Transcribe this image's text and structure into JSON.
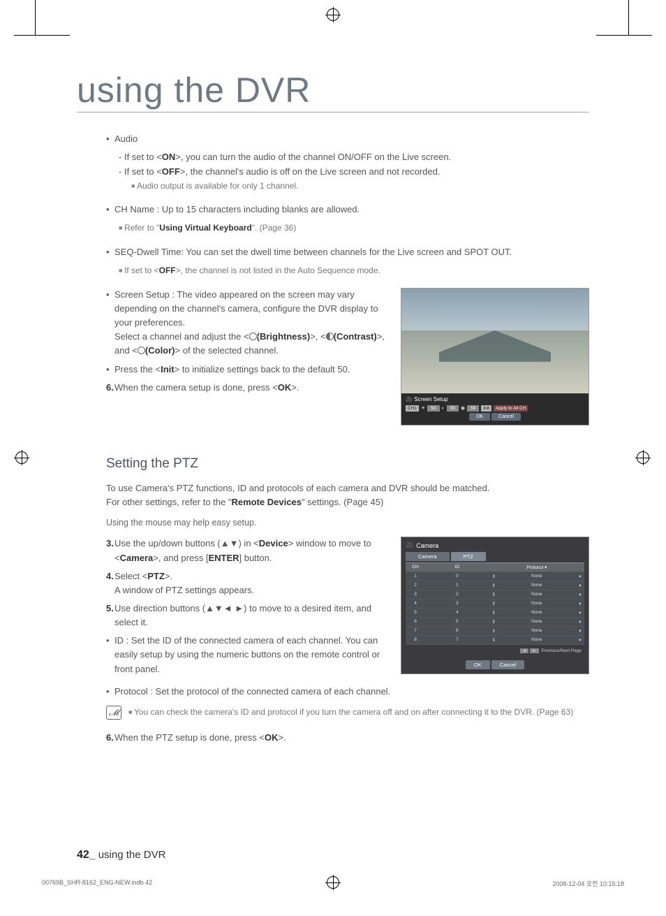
{
  "page": {
    "title": "using the DVR",
    "footer_page": "42_",
    "footer_text": "using the DVR",
    "footline_left": "00769B_SHR-8162_ENG-NEW.indb   42",
    "footline_right": "2008-12-04   오전 10:15:18"
  },
  "sec1": {
    "audio_label": "Audio",
    "audio_on": "If set to <",
    "audio_on_b": "ON",
    "audio_on_rest": ">, you can turn the audio of the channel ON/OFF on the Live screen.",
    "audio_off": "If set to <",
    "audio_off_b": "OFF",
    "audio_off_rest": ">, the channel's audio is off on the Live screen and not recorded.",
    "audio_note": "Audio output is available for only 1 channel.",
    "chname": "CH Name : Up to 15 characters including blanks are allowed.",
    "chname_note_a": "Refer to \"",
    "chname_note_b": "Using Virtual Keyboard",
    "chname_note_c": "\". (Page 36)",
    "seq": "SEQ-Dwell Time: You can set the dwell time between channels for the Live screen and SPOT OUT.",
    "seq_note_a": "If set to <",
    "seq_note_b": "OFF",
    "seq_note_c": ">, the channel is not listed in the Auto Sequence mode.",
    "screen1": "Screen Setup : The video appeared on the screen may vary depending on the channel's camera, configure the DVR display to your preferences.",
    "screen2a": "Select a channel and adjust the <",
    "brightness": "(Brightness)",
    "screen2b": ">, <",
    "contrast": "(Contrast)",
    "screen2c": ">, and <",
    "color": "(Color)",
    "screen2d": "> of the selected channel.",
    "init_a": "Press the <",
    "init_b": "Init",
    "init_c": "> to initialize settings back to the default 50.",
    "step6_a": "When the camera setup is done, press <",
    "step6_b": "OK",
    "step6_c": ">."
  },
  "ss1": {
    "title": "Screen Setup",
    "ch": "CH1",
    "v1": "50",
    "v2": "50",
    "v3": "50",
    "init": "Init",
    "apply": "Apply to All CH",
    "ok": "OK",
    "cancel": "Cancel"
  },
  "ptz": {
    "title": "Setting the PTZ",
    "intro1": "To use Camera's PTZ functions, ID and protocols of each camera and DVR should be matched.",
    "intro2_a": "For other settings, refer to the \"",
    "intro2_b": "Remote Devices",
    "intro2_c": "\" settings. (Page 45)",
    "mouse": "Using the mouse may help easy setup.",
    "s3_a": "Use the up/down buttons (▲▼) in <",
    "s3_b": "Device",
    "s3_c": "> window to move to <",
    "s3_d": "Camera",
    "s3_e": ">, and press [",
    "s3_f": "ENTER",
    "s3_g": "] button.",
    "s4_a": "Select <",
    "s4_b": "PTZ",
    "s4_c": ">.",
    "s4_d": "A window of PTZ settings appears.",
    "s5": "Use direction buttons (▲▼◄ ►) to move to a desired item, and select it.",
    "idline": "ID : Set the ID of the connected camera of each channel. You can easily setup by using the numeric buttons on the remote control or front panel.",
    "protoline": "Protocol : Set the protocol of the connected camera of each channel.",
    "note": "You can check the camera's ID and protocol if you turn the camera off and on after connecting it to the DVR. (Page 63)",
    "s6_a": "When the PTZ setup is done, press <",
    "s6_b": "OK",
    "s6_c": ">."
  },
  "ss2": {
    "window_title": "Camera",
    "tab1": "Camera",
    "tab2": "PTZ",
    "col_ch": "CH",
    "col_id": "ID",
    "col_proto": "Protocol ▾",
    "rows": [
      {
        "ch": "1",
        "id": "0",
        "proto": "None"
      },
      {
        "ch": "2",
        "id": "1",
        "proto": "None"
      },
      {
        "ch": "3",
        "id": "2",
        "proto": "None"
      },
      {
        "ch": "4",
        "id": "3",
        "proto": "None"
      },
      {
        "ch": "5",
        "id": "4",
        "proto": "None"
      },
      {
        "ch": "6",
        "id": "5",
        "proto": "None"
      },
      {
        "ch": "7",
        "id": "6",
        "proto": "None"
      },
      {
        "ch": "8",
        "id": "7",
        "proto": "None"
      }
    ],
    "pager": "Previous/Next Page",
    "ok": "OK",
    "cancel": "Cancel"
  },
  "numbers": {
    "n3": "3.",
    "n4": "4.",
    "n5": "5.",
    "n6": "6."
  }
}
